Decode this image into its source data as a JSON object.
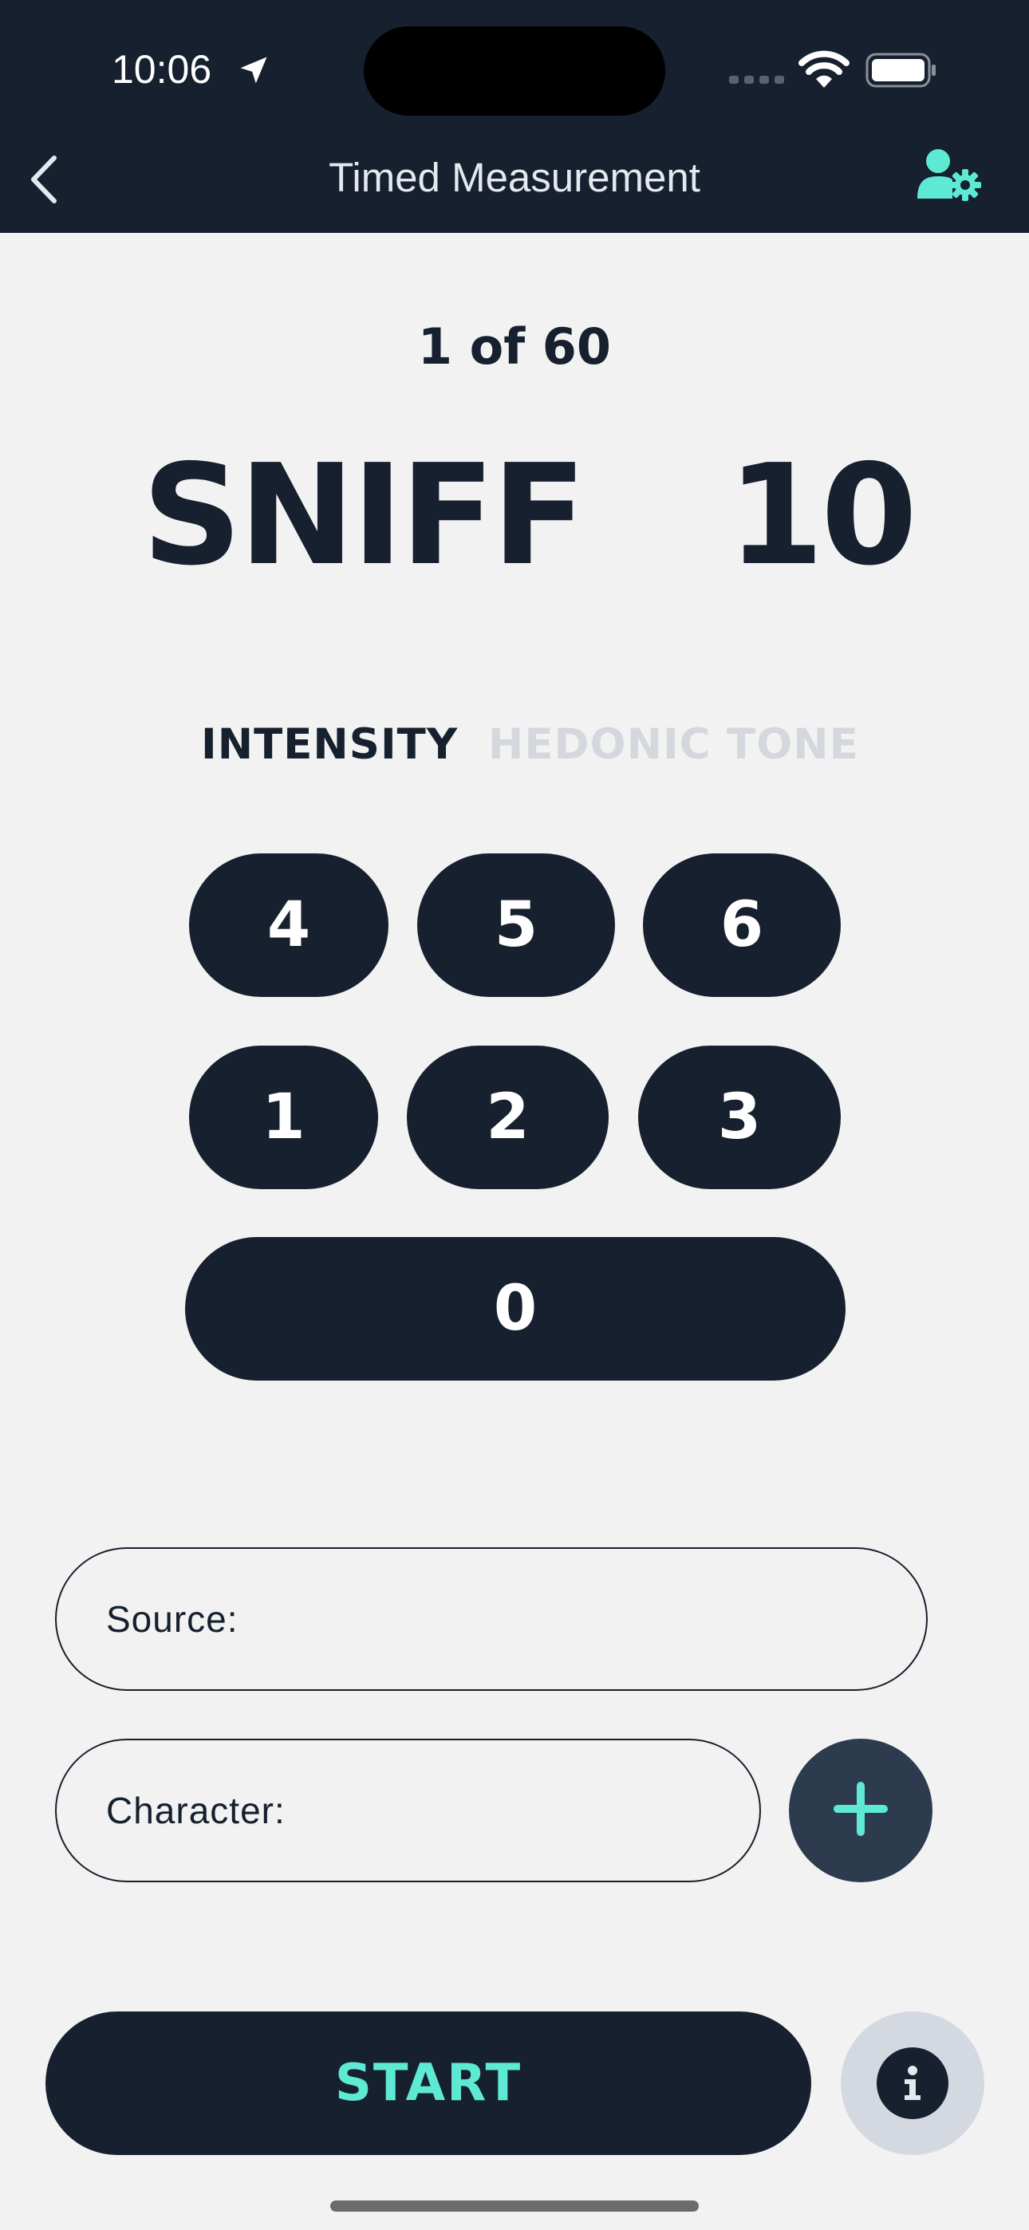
{
  "status_bar": {
    "time": "10:06"
  },
  "nav": {
    "title": "Timed Measurement"
  },
  "counter": "1 of 60",
  "phase": {
    "label": "SNIFF",
    "seconds": "10"
  },
  "tabs": [
    {
      "label": "INTENSITY",
      "active": true
    },
    {
      "label": "HEDONIC TONE",
      "active": false
    }
  ],
  "keypad": {
    "row1": [
      "4",
      "5",
      "6"
    ],
    "row2": [
      "1",
      "2",
      "3"
    ],
    "row3": [
      "0"
    ]
  },
  "fields": {
    "source_label": "Source:",
    "character_label": "Character:"
  },
  "buttons": {
    "start": "START"
  },
  "colors": {
    "navy": "#16202e",
    "accent": "#5ee9d5",
    "background": "#f2f2f2"
  }
}
